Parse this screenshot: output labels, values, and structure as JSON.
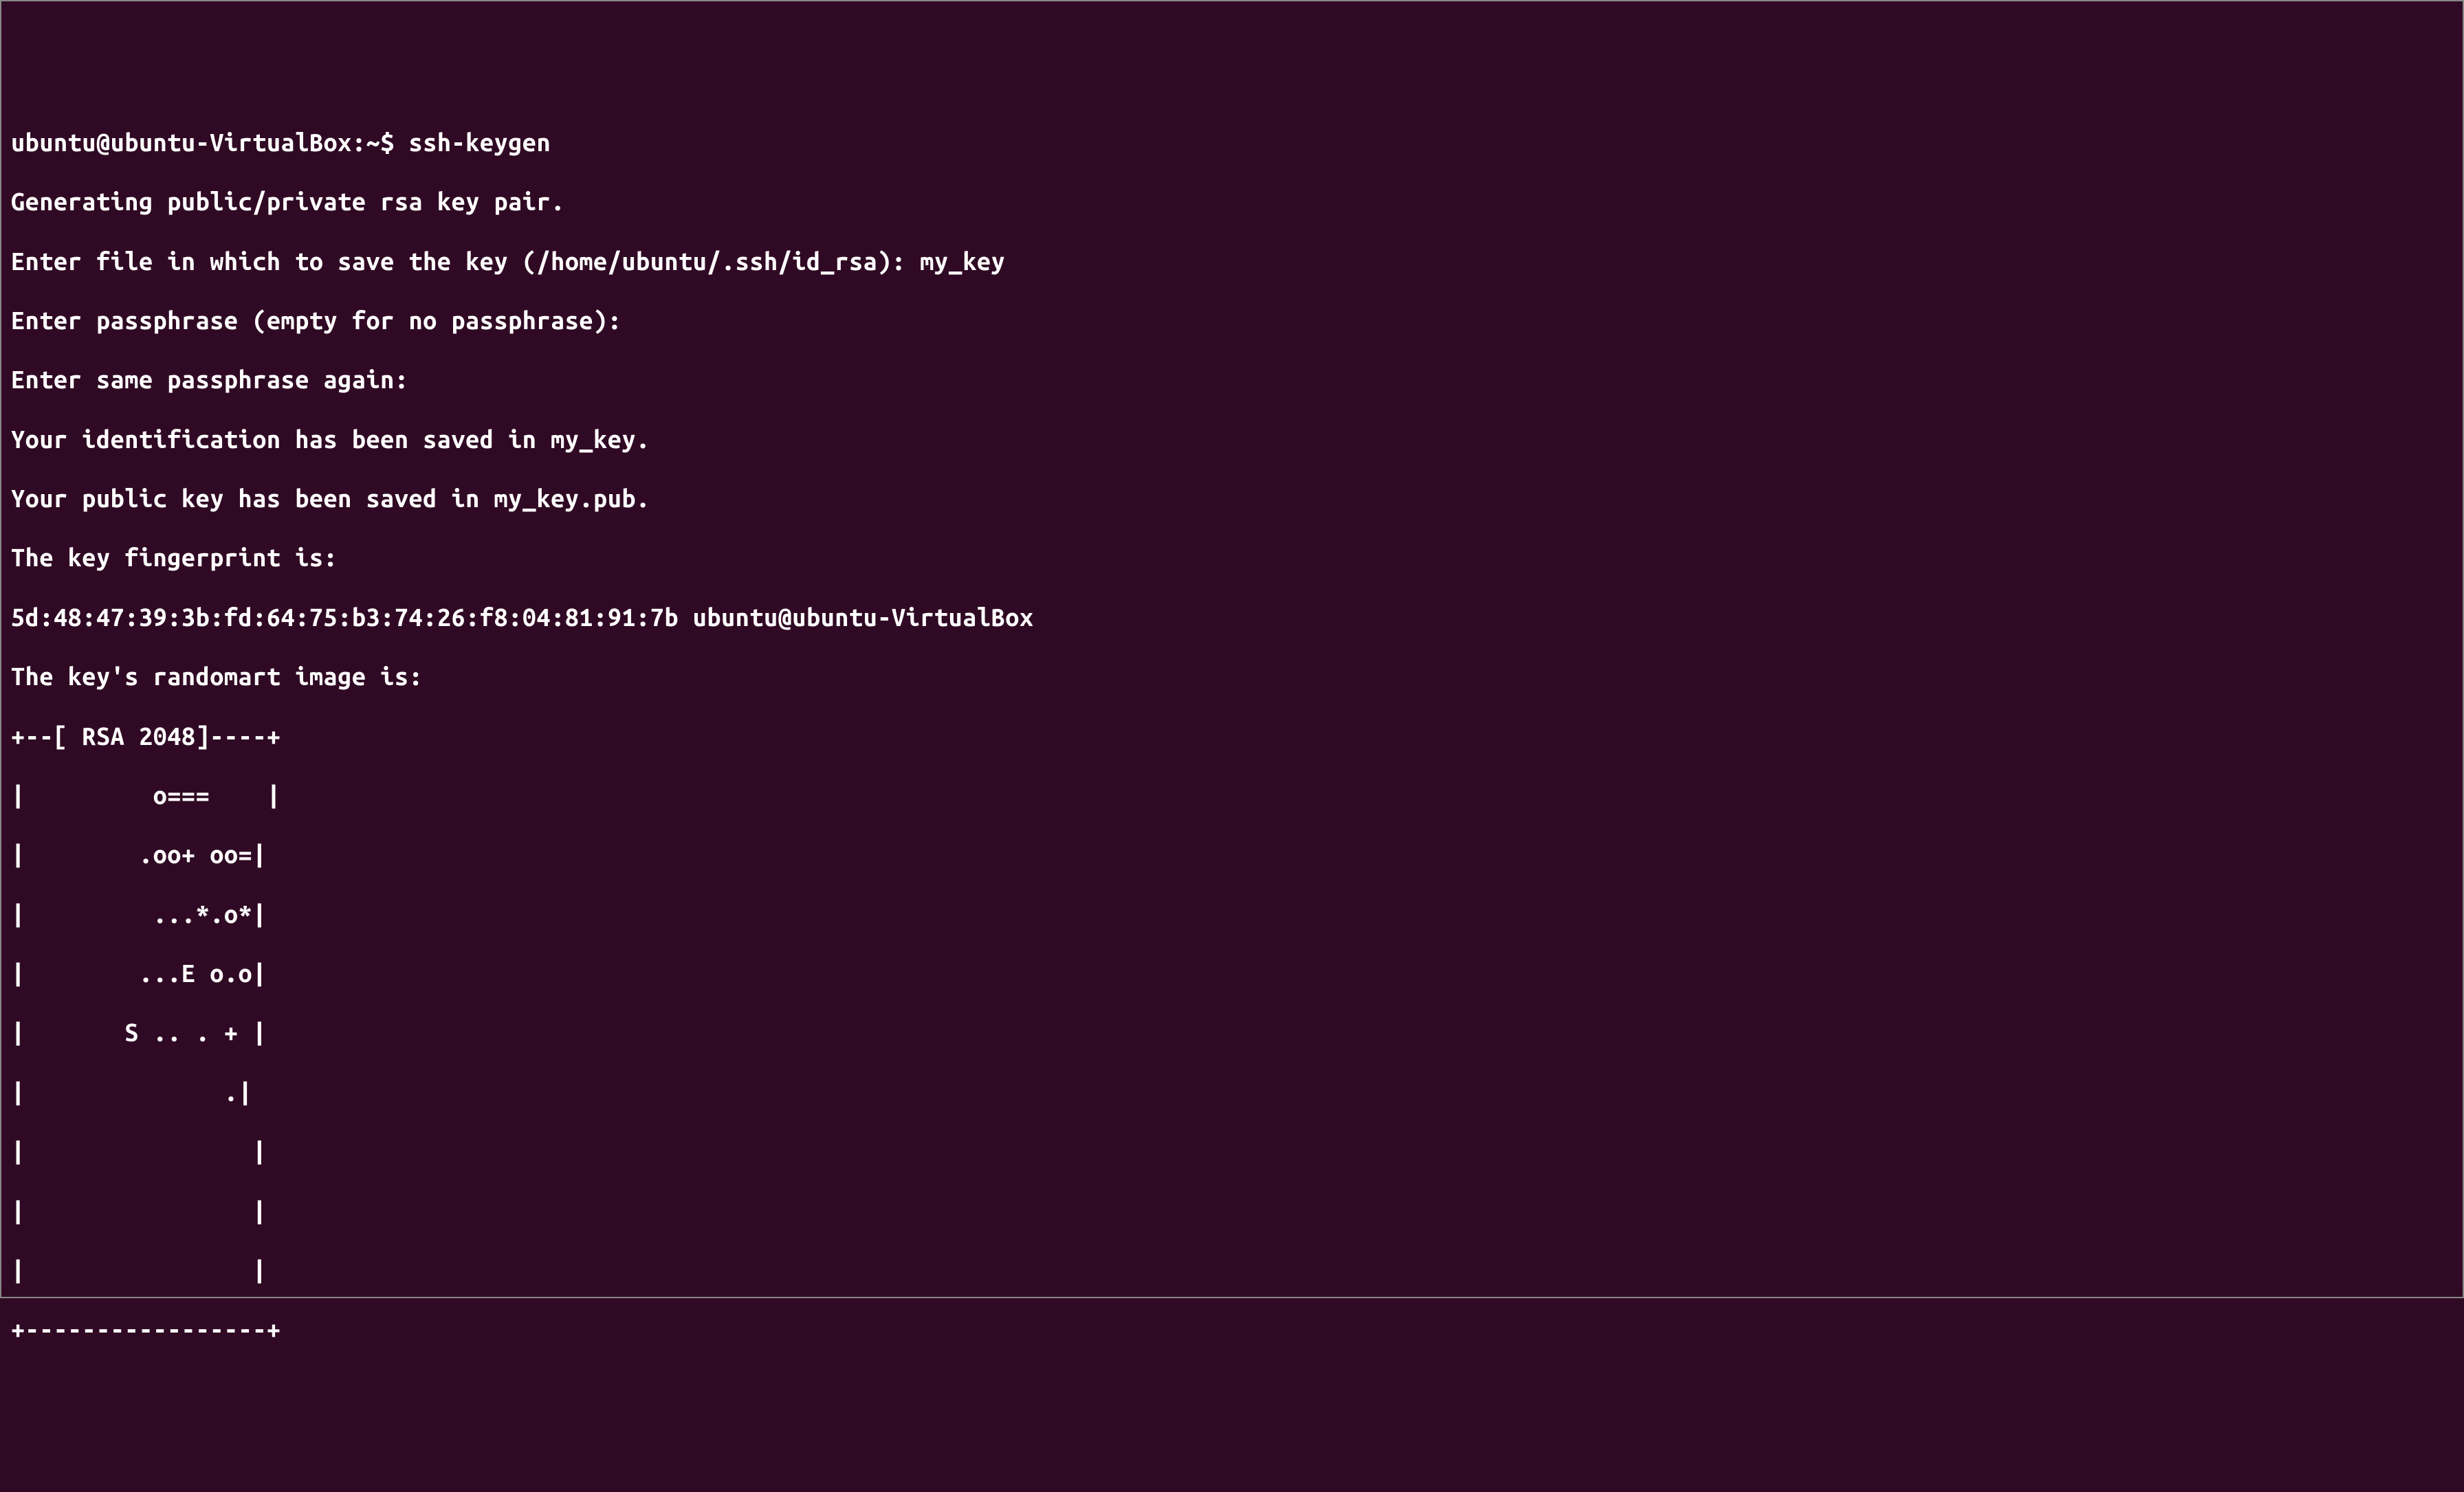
{
  "prompt": {
    "user_host": "ubuntu@ubuntu-VirtualBox",
    "separator": ":",
    "cwd": "~",
    "symbol": "$",
    "command": "ssh-keygen"
  },
  "output": {
    "generating": "Generating public/private rsa key pair.",
    "enter_file_prompt": "Enter file in which to save the key (/home/ubuntu/.ssh/id_rsa): ",
    "enter_file_input": "my_key",
    "enter_passphrase": "Enter passphrase (empty for no passphrase): ",
    "enter_passphrase_again": "Enter same passphrase again: ",
    "id_saved": "Your identification has been saved in my_key.",
    "pub_saved": "Your public key has been saved in my_key.pub.",
    "fingerprint_label": "The key fingerprint is:",
    "fingerprint_value": "5d:48:47:39:3b:fd:64:75:b3:74:26:f8:04:81:91:7b ubuntu@ubuntu-VirtualBox",
    "randomart_label": "The key's randomart image is:",
    "randomart": {
      "line0": "+--[ RSA 2048]----+",
      "line1": "|         o===    |",
      "line2": "|        .oo+ oo=|",
      "line3": "|         ...*.o*|",
      "line4": "|        ...E o.o|",
      "line5": "|       S .. . + |",
      "line6": "|              .|",
      "line7": "|                |",
      "line8": "|                |",
      "line9": "|                |",
      "line10": "+-----------------+"
    }
  }
}
